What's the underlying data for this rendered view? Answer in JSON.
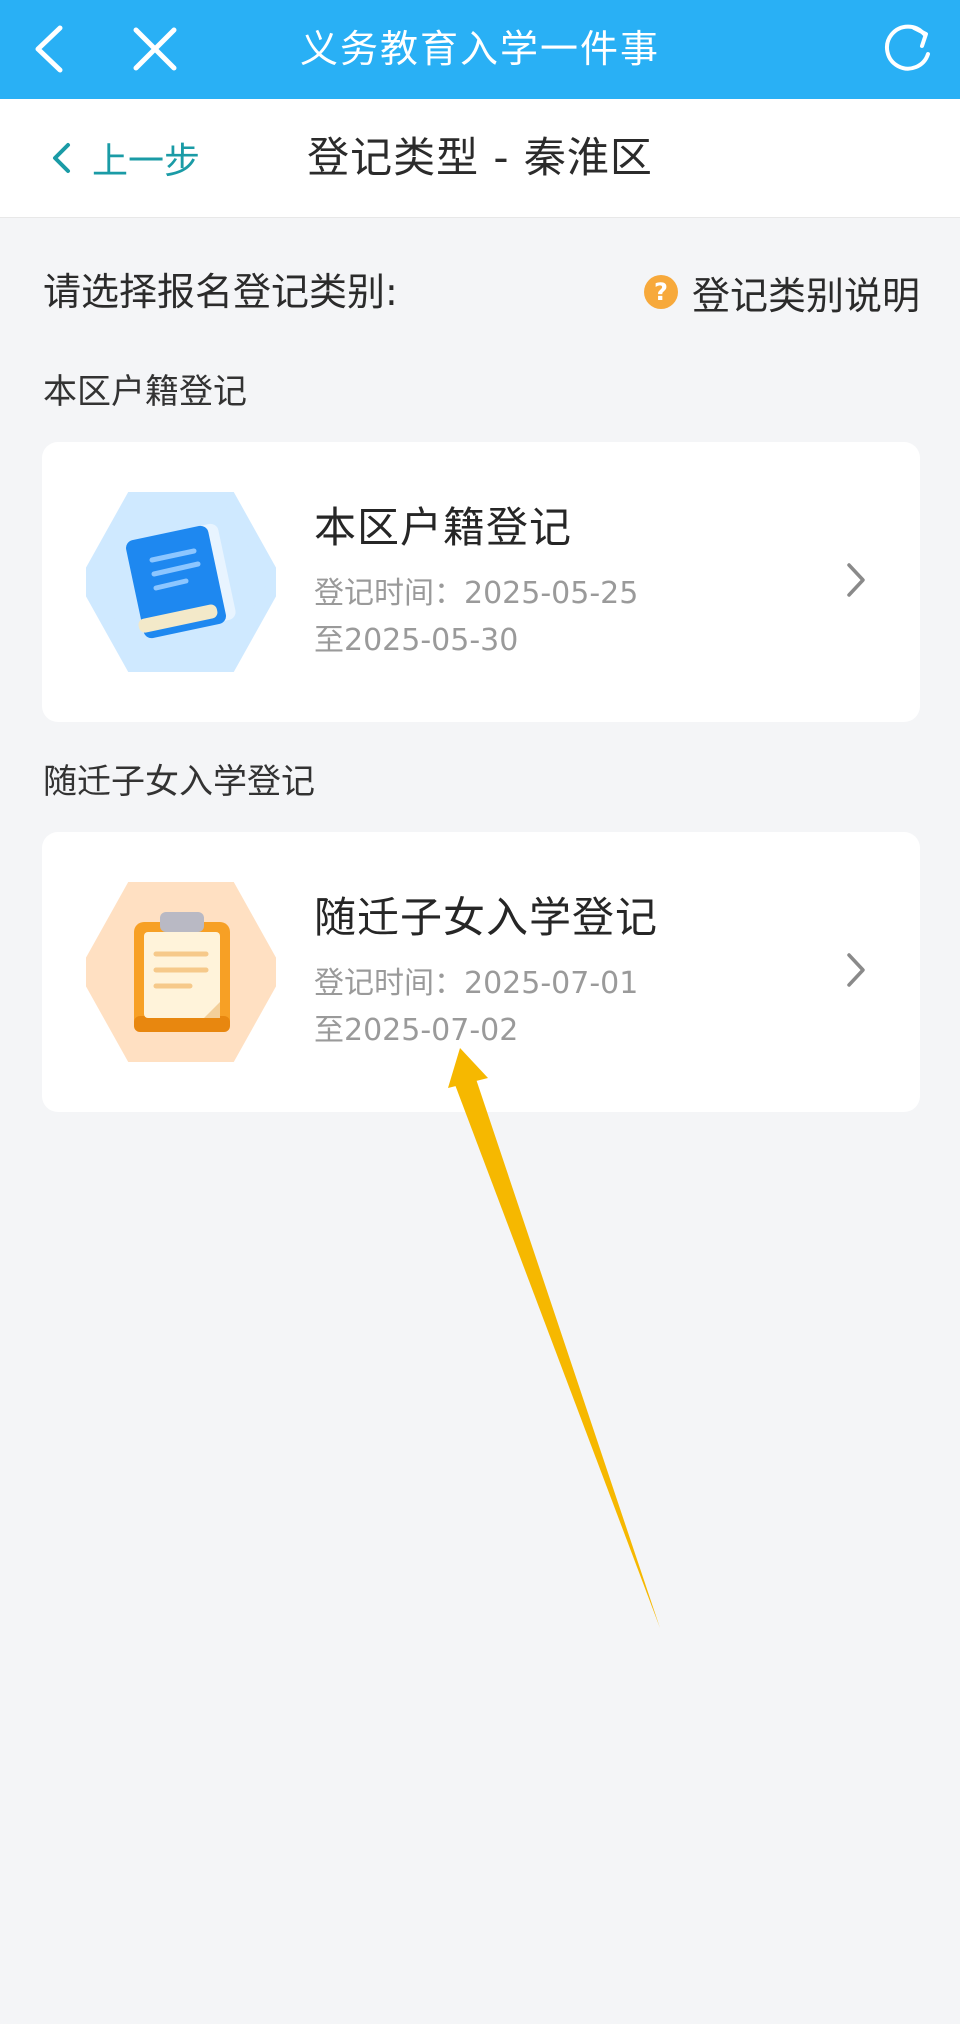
{
  "appbar": {
    "title": "义务教育入学一件事"
  },
  "navbar": {
    "prev_label": "上一步",
    "title": "登记类型 - 秦淮区"
  },
  "prompt": {
    "text": "请选择报名登记类别:",
    "help_label": "登记类别说明",
    "help_icon_glyph": "?"
  },
  "sections": [
    {
      "label": "本区户籍登记",
      "card": {
        "title": "本区户籍登记",
        "time_line1": "登记时间：2025-05-25",
        "time_line2": "至2025-05-30",
        "icon": "book-icon",
        "accent": "#1e88f0"
      }
    },
    {
      "label": "随迁子女入学登记",
      "card": {
        "title": "随迁子女入学登记",
        "time_line1": "登记时间：2025-07-01",
        "time_line2": "至2025-07-02",
        "icon": "clipboard-icon",
        "accent": "#f79a1e"
      }
    }
  ],
  "colors": {
    "appbar_bg": "#29b0f5",
    "link": "#1a9ba6",
    "help_badge": "#f7a93b",
    "annotation_arrow": "#f6b800"
  }
}
